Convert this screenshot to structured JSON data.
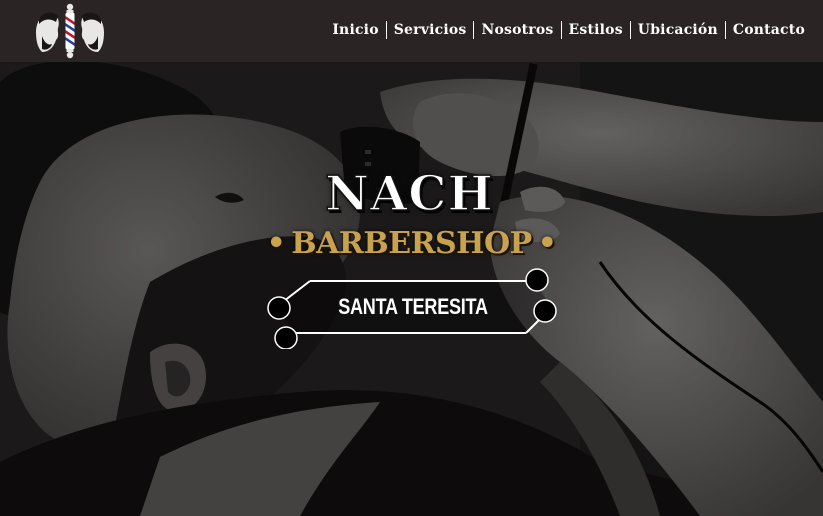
{
  "header": {
    "logo_icon": "barber-pole-logo-icon",
    "nav": [
      {
        "label": "Inicio"
      },
      {
        "label": "Servicios"
      },
      {
        "label": "Nosotros"
      },
      {
        "label": "Estilos"
      },
      {
        "label": "Ubicación"
      },
      {
        "label": "Contacto"
      }
    ]
  },
  "hero": {
    "title": "NACH",
    "subtitle": "BARBERSHOP",
    "subtitle_dot": "•",
    "location": "SANTA TERESITA",
    "background_icon": "barber-trimming-beard-photo",
    "colors": {
      "accent_gold": "#c9a24e",
      "header_bg": "#2a2424",
      "text": "#ffffff"
    }
  }
}
